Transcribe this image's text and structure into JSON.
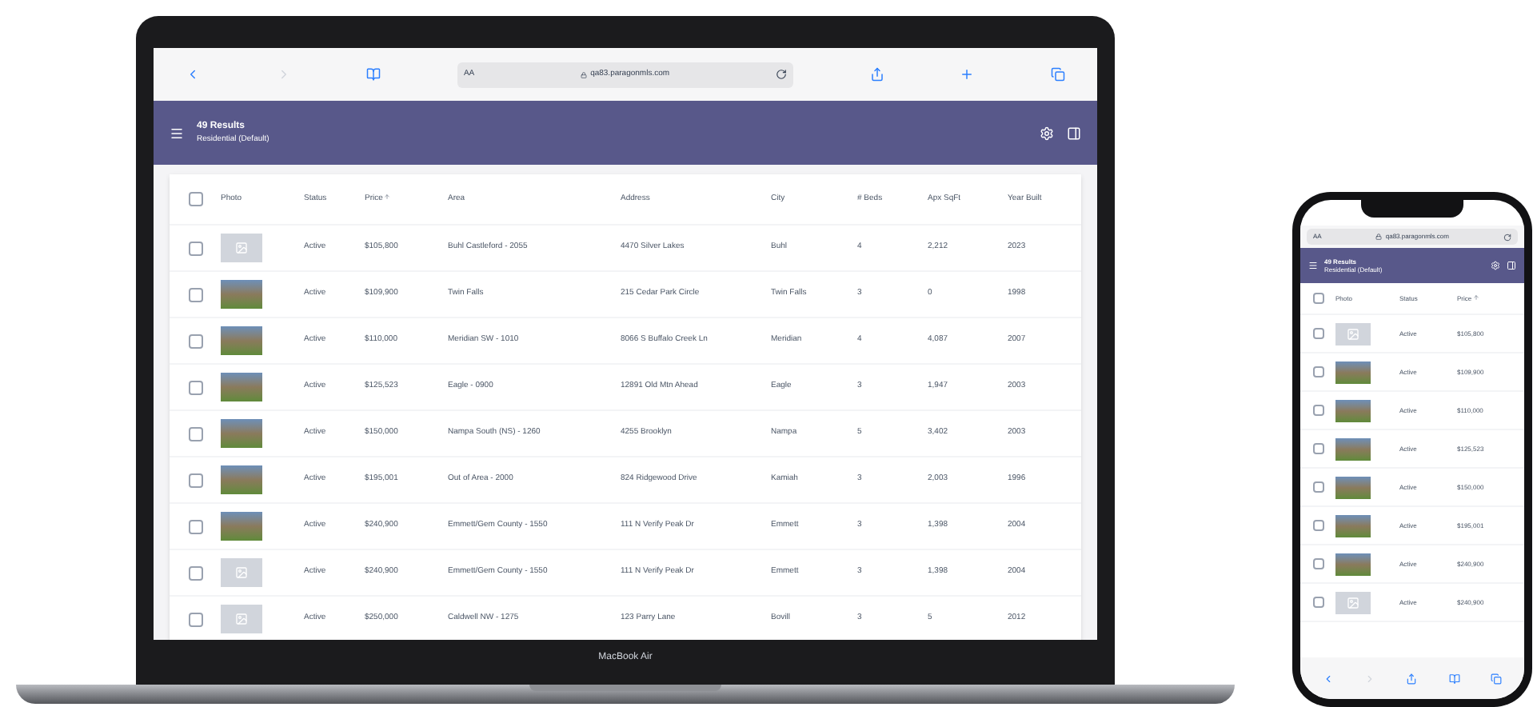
{
  "laptop": {
    "device_label": "MacBook Air",
    "browser": {
      "reader_label": "AA",
      "url": "qa83.paragonmls.com"
    },
    "header": {
      "title": "49 Results",
      "subtitle": "Residential (Default)"
    },
    "table": {
      "all_checked": false,
      "columns": [
        {
          "label": "Photo",
          "sorted": false
        },
        {
          "label": "Status",
          "sorted": false
        },
        {
          "label": "Price",
          "sorted": true
        },
        {
          "label": "Area",
          "sorted": false
        },
        {
          "label": "Address",
          "sorted": false
        },
        {
          "label": "City",
          "sorted": false
        },
        {
          "label": "# Beds",
          "sorted": false
        },
        {
          "label": "Apx SqFt",
          "sorted": false
        },
        {
          "label": "Year Built",
          "sorted": false
        }
      ],
      "rows": [
        {
          "checked": false,
          "kind": "placeholder",
          "cells": [
            "",
            "Active",
            "$105,800",
            "Buhl Castleford - 2055",
            "4470 Silver Lakes",
            "Buhl",
            "4",
            "2,212",
            "2023"
          ]
        },
        {
          "checked": false,
          "kind": "photo",
          "cells": [
            "",
            "Active",
            "$109,900",
            "Twin Falls",
            "215 Cedar Park Circle",
            "Twin Falls",
            "3",
            "0",
            "1998"
          ]
        },
        {
          "checked": false,
          "kind": "photo",
          "cells": [
            "",
            "Active",
            "$110,000",
            "Meridian SW - 1010",
            "8066 S Buffalo Creek Ln",
            "Meridian",
            "4",
            "4,087",
            "2007"
          ]
        },
        {
          "checked": false,
          "kind": "photo",
          "cells": [
            "",
            "Active",
            "$125,523",
            "Eagle - 0900",
            "12891 Old Mtn Ahead",
            "Eagle",
            "3",
            "1,947",
            "2003"
          ]
        },
        {
          "checked": false,
          "kind": "photo",
          "cells": [
            "",
            "Active",
            "$150,000",
            "Nampa South (NS) - 1260",
            "4255 Brooklyn",
            "Nampa",
            "5",
            "3,402",
            "2003"
          ]
        },
        {
          "checked": false,
          "kind": "photo",
          "cells": [
            "",
            "Active",
            "$195,001",
            "Out of Area - 2000",
            "824 Ridgewood Drive",
            "Kamiah",
            "3",
            "2,003",
            "1996"
          ]
        },
        {
          "checked": false,
          "kind": "photo",
          "cells": [
            "",
            "Active",
            "$240,900",
            "Emmett/Gem County - 1550",
            "111 N Verify Peak Dr",
            "Emmett",
            "3",
            "1,398",
            "2004"
          ]
        },
        {
          "checked": false,
          "kind": "placeholder",
          "cells": [
            "",
            "Active",
            "$240,900",
            "Emmett/Gem County - 1550",
            "111 N Verify Peak Dr",
            "Emmett",
            "3",
            "1,398",
            "2004"
          ]
        },
        {
          "checked": false,
          "kind": "placeholder",
          "cells": [
            "",
            "Active",
            "$250,000",
            "Caldwell NW - 1275",
            "123 Parry Lane",
            "Bovill",
            "3",
            "5",
            "2012"
          ]
        }
      ]
    }
  },
  "phone": {
    "browser": {
      "reader_label": "AA",
      "url": "qa83.paragonmls.com"
    },
    "header": {
      "title": "49 Results",
      "subtitle": "Residential (Default)"
    },
    "table": {
      "all_checked": false,
      "columns": [
        {
          "label": "Photo",
          "sorted": false
        },
        {
          "label": "Status",
          "sorted": false
        },
        {
          "label": "Price",
          "sorted": true
        }
      ],
      "rows": [
        {
          "checked": false,
          "kind": "placeholder",
          "cells": [
            "",
            "Active",
            "$105,800"
          ]
        },
        {
          "checked": false,
          "kind": "photo",
          "cells": [
            "",
            "Active",
            "$109,900"
          ]
        },
        {
          "checked": false,
          "kind": "photo",
          "cells": [
            "",
            "Active",
            "$110,000"
          ]
        },
        {
          "checked": false,
          "kind": "photo",
          "cells": [
            "",
            "Active",
            "$125,523"
          ]
        },
        {
          "checked": false,
          "kind": "photo",
          "cells": [
            "",
            "Active",
            "$150,000"
          ]
        },
        {
          "checked": false,
          "kind": "photo",
          "cells": [
            "",
            "Active",
            "$195,001"
          ]
        },
        {
          "checked": false,
          "kind": "photo",
          "cells": [
            "",
            "Active",
            "$240,900"
          ]
        },
        {
          "checked": false,
          "kind": "placeholder",
          "cells": [
            "",
            "Active",
            "$240,900"
          ]
        }
      ]
    }
  }
}
